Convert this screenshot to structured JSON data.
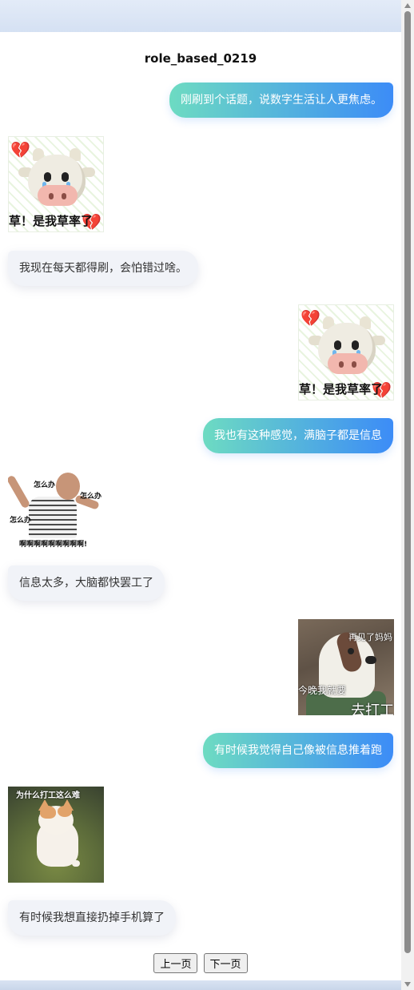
{
  "title": "role_based_0219",
  "messages": [
    {
      "role": "user",
      "text": "刚刷到个话题，说数字生活让人更焦虑。"
    },
    {
      "role": "bot",
      "sticker": "crying-cow-sticker",
      "caption": "草！是我草率了"
    },
    {
      "role": "bot",
      "text": "我现在每天都得刷，会怕错过啥。"
    },
    {
      "role": "user",
      "sticker": "crying-cow-sticker",
      "caption": "草！是我草率了"
    },
    {
      "role": "user",
      "text": "我也有这种感觉，满脑子都是信息"
    },
    {
      "role": "bot",
      "sticker": "panicking-man-sticker",
      "captions": [
        "怎么办",
        "怎么办",
        "怎么办",
        "啊啊啊啊啊啊啊啊啊!"
      ]
    },
    {
      "role": "bot",
      "text": "信息太多，大脑都快罢工了"
    },
    {
      "role": "user",
      "sticker": "dog-leaving-sticker",
      "captions": [
        "再见了妈妈",
        "今晚我就要",
        "去打工"
      ]
    },
    {
      "role": "user",
      "text": "有时候我觉得自己像被信息推着跑"
    },
    {
      "role": "bot",
      "sticker": "sad-cat-sticker",
      "caption": "为什么打工这么难"
    },
    {
      "role": "bot",
      "text": "有时候我想直接扔掉手机算了"
    }
  ],
  "pager": {
    "prev": "上一页",
    "next": "下一页"
  },
  "colors": {
    "user_bubble_start": "#6ddbc2",
    "user_bubble_end": "#3c8cf7",
    "bot_bubble": "#f1f3f8"
  }
}
